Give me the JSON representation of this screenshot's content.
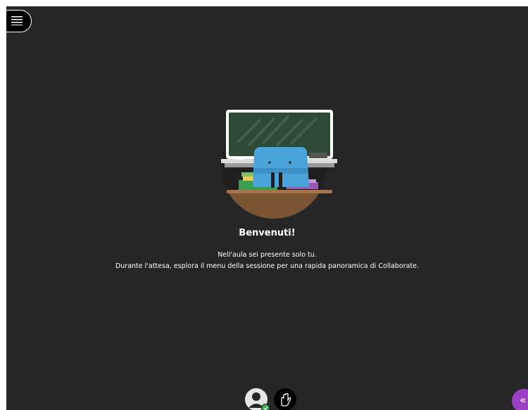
{
  "session": {
    "welcome_title": "Benvenuti!",
    "message_line1": "Nell'aula sei presente solo tu.",
    "message_line2": "Durante l'attesa, esplora il menu della sessione per una rapida panoramica di Collaborate."
  },
  "icons": {
    "menu": "hamburger-menu-icon",
    "avatar": "user-avatar-icon",
    "status": "check-icon",
    "raise_hand": "raise-hand-icon",
    "panel": "double-chevron-left-icon"
  },
  "colors": {
    "background": "#262626",
    "accent_purple": "#9b3fc4",
    "status_green": "#3aa757"
  }
}
